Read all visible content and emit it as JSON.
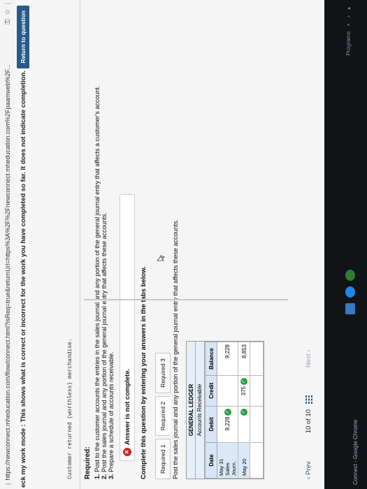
{
  "browser": {
    "url": "https://newconnect.mheducation.com/flow/connect.html?isReq=true&returnUrl=https%3A%2F%2Fnewconnect.mheducation.com%2Fpaamweb%2F..."
  },
  "check_bar": {
    "message": "eck my work mode : This shows what is correct or incorrect for the work you have completed so far. It does not indicate completion.",
    "return_label": "Return to question"
  },
  "question": {
    "purchase_note": "Customer returned (worthless) merchandise.",
    "required_heading": "Required:",
    "req1_num": "1.",
    "req1_text": "Post to the customer accounts the entries in the sales journal and any portion of the general journal entry that affects a customer's account.",
    "req2_num": "2.",
    "req2_text": "Post the sales journal and any portion of the general journal entry that affects these accounts.",
    "req3_num": "3.",
    "req3_text": "Prepare a schedule of accounts receivable."
  },
  "banner": {
    "text": "Answer is not complete."
  },
  "instructions": "Complete this question by entering your answers in the tabs below.",
  "tabs": [
    {
      "label": "Required 1"
    },
    {
      "label": "Required 2"
    },
    {
      "label": "Required 3"
    }
  ],
  "post_instruction": "Post the sales journal and any portion of the general journal entry that affects these accounts.",
  "ledger": {
    "title": "GENERAL LEDGER",
    "subtitle": "Accounts Receivable",
    "headers": [
      "Date",
      "Debit",
      "Credit",
      "Balance"
    ],
    "rows": [
      {
        "date_line1": "May 31 Sales",
        "date_line2": "Journ.",
        "debit": "9,228",
        "credit": "",
        "balance": "9,228"
      },
      {
        "date_line1": "May 20",
        "date_line2": "",
        "debit": "",
        "credit": "375",
        "balance": "8,853"
      }
    ]
  },
  "pager": {
    "prev": "Prev",
    "count": "10 of 10",
    "next": "Next"
  },
  "taskbar": {
    "title": "Connect - Google Chrome",
    "programs": "Programs"
  }
}
